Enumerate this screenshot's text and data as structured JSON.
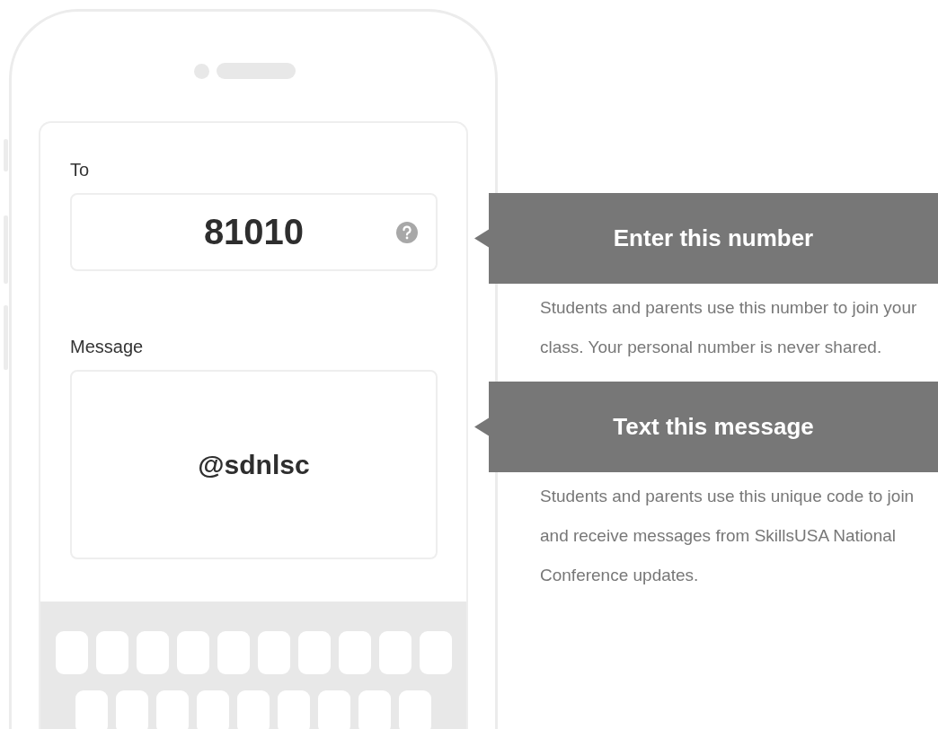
{
  "phone": {
    "to_label": "To",
    "to_value": "81010",
    "message_label": "Message",
    "message_value": "@sdnlsc"
  },
  "callouts": [
    {
      "title": "Enter this number",
      "description": "Students and parents use this number to join your class. Your personal number is never shared."
    },
    {
      "title": "Text this message",
      "description": "Students and parents use this unique code to join and receive messages from SkillsUSA National Conference updates."
    }
  ]
}
